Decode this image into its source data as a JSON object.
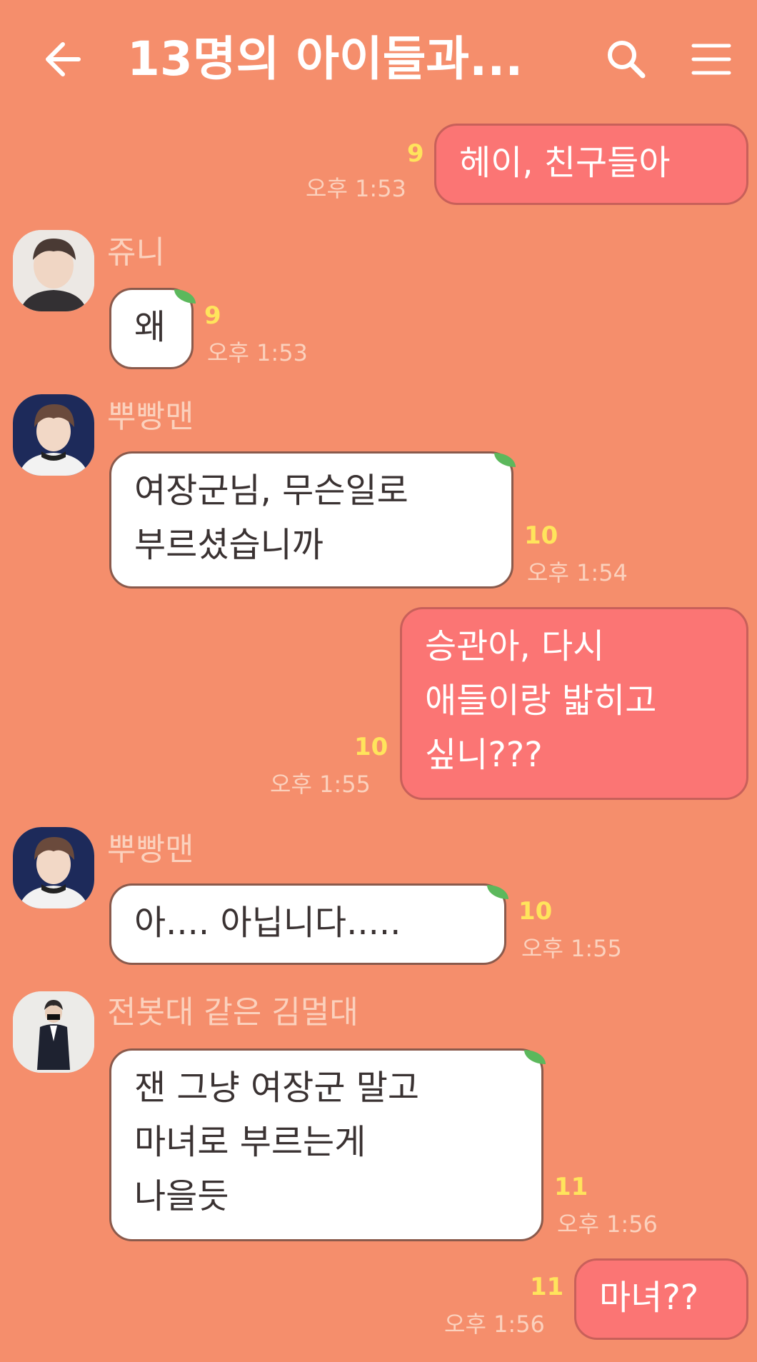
{
  "header": {
    "title": "13명의 아이들과...",
    "back_icon": "arrow-left-icon",
    "search_icon": "search-icon",
    "menu_icon": "hamburger-menu-icon"
  },
  "colors": {
    "background": "#f58e6c",
    "my_bubble": "#fb7574",
    "other_bubble": "#ffffff",
    "unread": "#ffe45c",
    "meta_text": "#fbd1bd"
  },
  "messages": [
    {
      "sender": "",
      "mine": true,
      "lines": [
        "헤이, 친구들아"
      ],
      "unread": "9",
      "time": "오후 1:53"
    },
    {
      "sender": "쥬니",
      "mine": false,
      "lines": [
        "왜"
      ],
      "unread": "9",
      "time": "오후 1:53"
    },
    {
      "sender": "뿌빵맨",
      "mine": false,
      "lines": [
        "여장군님, 무슨일로",
        "부르셨습니까"
      ],
      "unread": "10",
      "time": "오후 1:54"
    },
    {
      "sender": "",
      "mine": true,
      "lines": [
        "승관아, 다시",
        "애들이랑 밟히고",
        "싶니???"
      ],
      "unread": "10",
      "time": "오후 1:55"
    },
    {
      "sender": "뿌빵맨",
      "mine": false,
      "lines": [
        "아.... 아닙니다....."
      ],
      "unread": "10",
      "time": "오후 1:55"
    },
    {
      "sender": "전봇대 같은 김멀대",
      "mine": false,
      "lines": [
        "잰 그냥 여장군 말고",
        "마녀로 부르는게",
        "나을듯"
      ],
      "unread": "11",
      "time": "오후 1:56"
    },
    {
      "sender": "",
      "mine": true,
      "lines": [
        "마녀??"
      ],
      "unread": "11",
      "time": "오후 1:56"
    }
  ]
}
